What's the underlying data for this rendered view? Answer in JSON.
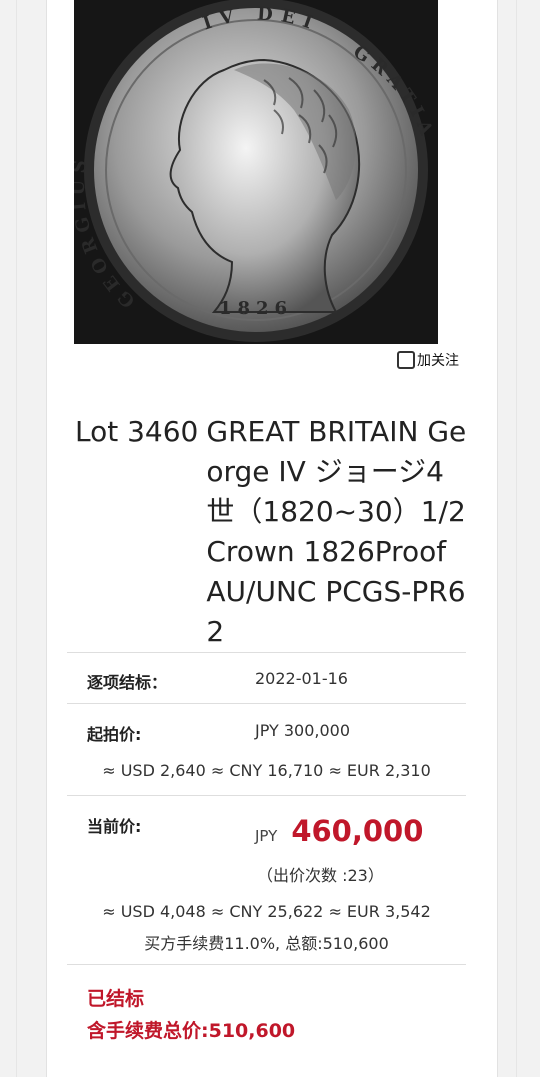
{
  "follow_label": "加关注",
  "lot": {
    "number": "Lot 3460",
    "title": "GREAT BRITAIN George IV ジョージ4世（1820~30）1/2Crown 1826Proof AU/UNC PCGS-PR62"
  },
  "coin_legend": {
    "left": "GEORGIUS",
    "top": "IV DEI",
    "right": "GRATIA",
    "date": "1826"
  },
  "close_date": {
    "label": "逐项结标：",
    "value": "2022-01-16"
  },
  "start_price": {
    "label": "起拍价:",
    "value": "JPY 300,000",
    "converted": "≈ USD 2,640 ≈ CNY 16,710 ≈ EUR 2,310"
  },
  "current_price": {
    "label": "当前价:",
    "currency": "JPY",
    "value": "460,000",
    "bids": "（出价次数 :23）",
    "converted": "≈ USD 4,048 ≈ CNY 25,622 ≈ EUR 3,542",
    "fee_note": "买方手续费11.0%, 总额:510,600"
  },
  "status": {
    "closed": "已结标",
    "total": "含手续费总价:510,600"
  },
  "colors": {
    "accent": "#c0172a"
  }
}
